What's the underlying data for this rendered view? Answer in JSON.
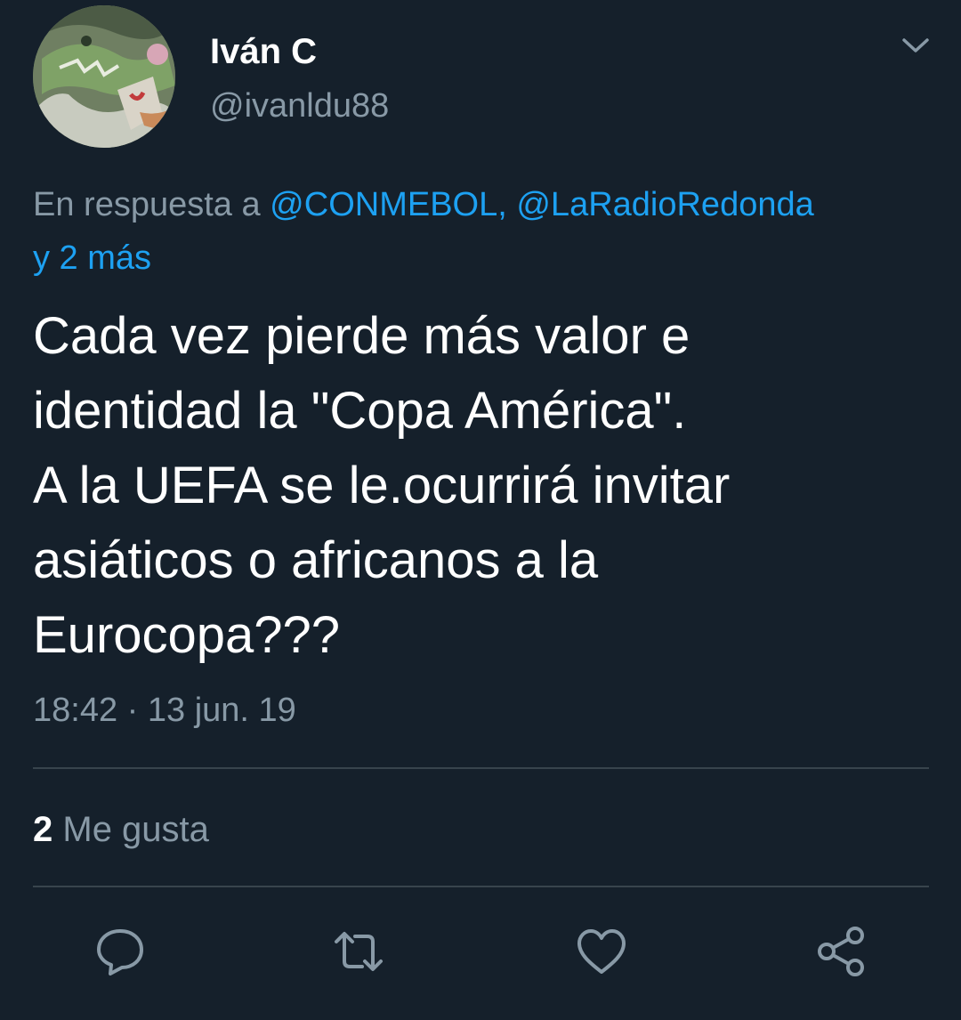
{
  "tweet": {
    "author": {
      "display_name": "Iván C",
      "handle": "@ivanldu88"
    },
    "reply_context": {
      "prefix": "En respuesta a",
      "mention_1": "@CONMEBOL,",
      "mention_2": "@LaRadioRedonda",
      "more": "y 2 más"
    },
    "text": "Cada vez pierde más valor e\nidentidad la \"Copa América\".\nA la UEFA se le.ocurrirá invitar\nasiáticos o africanos a la\nEurocopa???",
    "timestamp": "18:42 · 13 jun. 19",
    "likes": {
      "count": "2",
      "label": "Me gusta"
    }
  },
  "icons": {
    "menu": "chevron-down-icon",
    "reply": "reply-icon",
    "retweet": "retweet-icon",
    "like": "heart-icon",
    "share": "share-icon"
  },
  "colors": {
    "background": "#15202b",
    "primary_text": "#ffffff",
    "secondary_text": "#8899a6",
    "link": "#1da1f2",
    "divider": "#38444d"
  }
}
